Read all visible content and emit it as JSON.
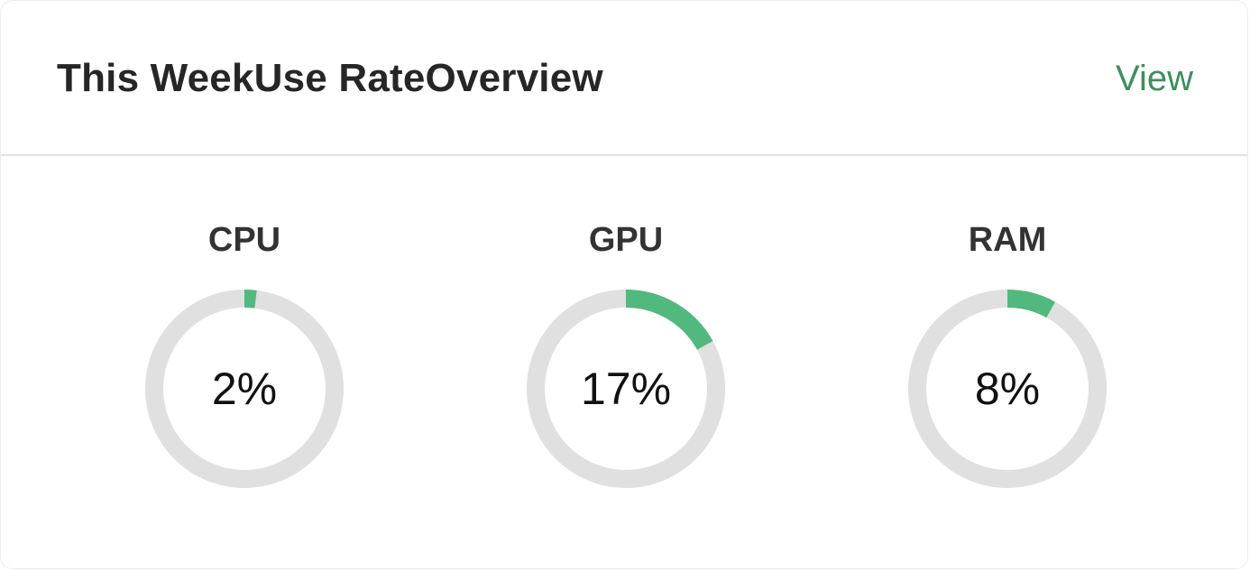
{
  "header": {
    "title": "This WeekUse RateOverview",
    "view_label": "View"
  },
  "colors": {
    "accent": "#52b97e",
    "track": "#e0e0e0",
    "link": "#3f8f5c"
  },
  "gauges": [
    {
      "label": "CPU",
      "value": 2,
      "value_text": "2%"
    },
    {
      "label": "GPU",
      "value": 17,
      "value_text": "17%"
    },
    {
      "label": "RAM",
      "value": 8,
      "value_text": "8%"
    }
  ]
}
